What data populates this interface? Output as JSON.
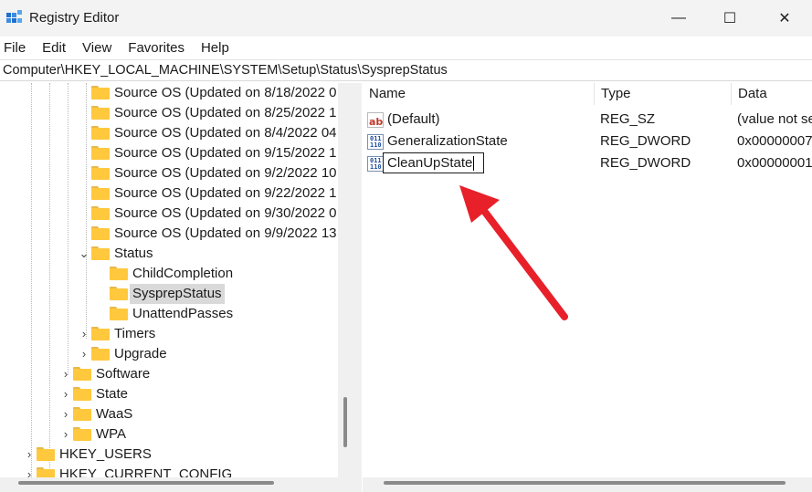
{
  "window": {
    "title": "Registry Editor",
    "minimize_glyph": "—",
    "maximize_glyph": "☐",
    "close_glyph": "✕"
  },
  "menu": [
    "File",
    "Edit",
    "View",
    "Favorites",
    "Help"
  ],
  "address": "Computer\\HKEY_LOCAL_MACHINE\\SYSTEM\\Setup\\Status\\SysprepStatus",
  "tree": [
    {
      "label": "Source OS (Updated on 8/18/2022 0",
      "chevron": ""
    },
    {
      "label": "Source OS (Updated on 8/25/2022 1",
      "chevron": ""
    },
    {
      "label": "Source OS (Updated on 8/4/2022 04",
      "chevron": ""
    },
    {
      "label": "Source OS (Updated on 9/15/2022 1",
      "chevron": ""
    },
    {
      "label": "Source OS (Updated on 9/2/2022 10",
      "chevron": ""
    },
    {
      "label": "Source OS (Updated on 9/22/2022 1",
      "chevron": ""
    },
    {
      "label": "Source OS (Updated on 9/30/2022 0",
      "chevron": ""
    },
    {
      "label": "Source OS (Updated on 9/9/2022 13",
      "chevron": ""
    },
    {
      "label": "Status",
      "chevron": "⌄"
    },
    {
      "label": "ChildCompletion",
      "chevron": ""
    },
    {
      "label": "SysprepStatus",
      "chevron": "",
      "selected": true
    },
    {
      "label": "UnattendPasses",
      "chevron": ""
    },
    {
      "label": "Timers",
      "chevron": "›"
    },
    {
      "label": "Upgrade",
      "chevron": "›"
    },
    {
      "label": "Software",
      "chevron": "›"
    },
    {
      "label": "State",
      "chevron": "›"
    },
    {
      "label": "WaaS",
      "chevron": "›"
    },
    {
      "label": "WPA",
      "chevron": "›"
    },
    {
      "label": "HKEY_USERS",
      "chevron": "›"
    },
    {
      "label": "HKEY_CURRENT_CONFIG",
      "chevron": "›"
    }
  ],
  "columns": {
    "name": "Name",
    "type": "Type",
    "data": "Data"
  },
  "values": [
    {
      "name": "(Default)",
      "type": "REG_SZ",
      "data": "(value not se",
      "icon": "string-value-icon"
    },
    {
      "name": "GeneralizationState",
      "type": "REG_DWORD",
      "data": "0x00000007",
      "icon": "binary-value-icon"
    },
    {
      "name": "CleanUpState",
      "type": "REG_DWORD",
      "data": "0x00000001",
      "icon": "binary-value-icon",
      "editing": true
    }
  ],
  "icon_glyphs": {
    "string": "ab",
    "binary": "011\n110"
  },
  "colors": {
    "annotation_arrow": "#e8202a",
    "folder": "#ffc83d",
    "selection": "#d9d9d9"
  }
}
